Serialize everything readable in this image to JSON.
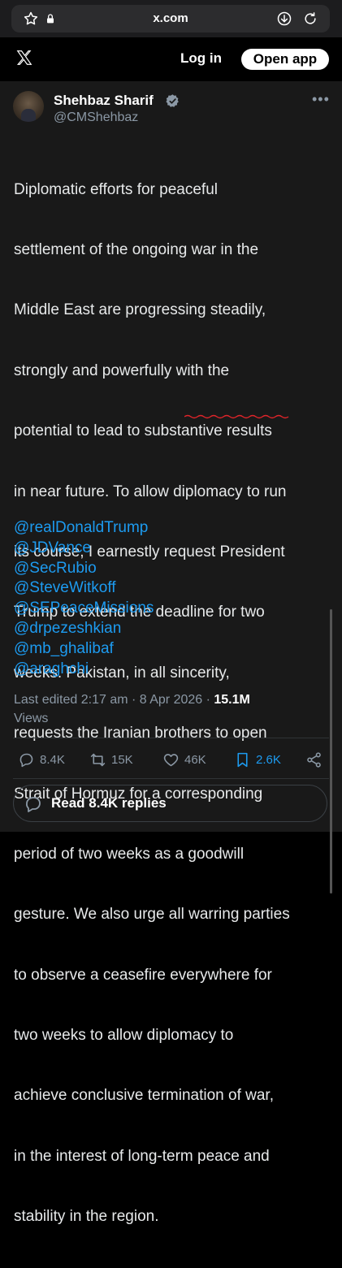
{
  "browser": {
    "url": "x.com"
  },
  "header": {
    "login_label": "Log in",
    "open_app_label": "Open app"
  },
  "tweet": {
    "author_name": "Shehbaz Sharif",
    "author_handle": "@CMShehbaz",
    "body_lines": [
      "Diplomatic efforts for peaceful",
      "settlement of the ongoing war in the",
      "Middle East are progressing steadily,",
      "strongly and powerfully with the",
      "potential to lead to substantive results",
      "in near future. To allow diplomacy to run",
      "its course, I earnestly request President",
      "Trump to extend the deadline for two",
      "weeks. Pakistan, in all sincerity,",
      "requests the Iranian brothers to open",
      "Strait of Hormuz for a corresponding",
      "period of two weeks as a goodwill",
      "gesture. We also urge all warring parties",
      "to observe a ceasefire everywhere for",
      "two weeks to allow diplomacy to",
      "achieve conclusive termination of war,",
      "in the interest of long-term peace and",
      "stability in the region."
    ],
    "mentions": [
      "@realDonaldTrump",
      "@JDVance",
      "@SecRubio",
      "@SteveWitkoff",
      "@SEPeaceMissions",
      "@drpezeshkian",
      "@mb_ghalibaf",
      "@araghchi"
    ],
    "meta_edited": "Last edited 2:17 am · 8 Apr 2026 · ",
    "meta_views_count": "15.1M",
    "meta_views_label": "Views"
  },
  "actions": {
    "replies": "8.4K",
    "reposts": "15K",
    "likes": "46K",
    "bookmarks": "2.6K"
  },
  "read_replies_label": "Read 8.4K replies",
  "colors": {
    "accent": "#1d9bf0",
    "background": "#191919",
    "muted": "#8b98a5"
  }
}
